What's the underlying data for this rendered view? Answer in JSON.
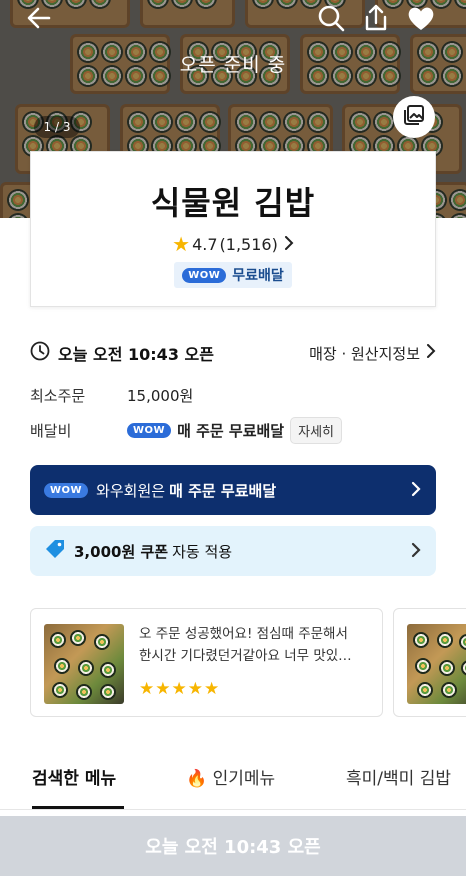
{
  "hero": {
    "status_overlay": "오픈 준비 중",
    "photo_counter": "1 / 3",
    "icons": [
      "back-arrow-icon",
      "search-icon",
      "share-icon",
      "heart-icon",
      "gallery-icon"
    ]
  },
  "store": {
    "name": "식물원 김밥",
    "rating": "4.7",
    "review_count": "(1,516)",
    "wow_badge": "WOW",
    "free_delivery_label": "무료배달"
  },
  "hours": {
    "text": "오늘 오전 10:43 오픈",
    "store_info_link": "매장 · 원산지정보"
  },
  "min_order": {
    "label": "최소주문",
    "value": "15,000원"
  },
  "delivery_fee": {
    "label": "배달비",
    "wow_badge": "WOW",
    "value": "매 주문 무료배달",
    "detail_button": "자세히"
  },
  "wow_banner": {
    "badge": "WOW",
    "prefix": "와우회원은",
    "highlight": "매 주문 무료배달"
  },
  "coupon_banner": {
    "amount": "3,000원 쿠폰",
    "suffix": "자동 적용"
  },
  "reviews": [
    {
      "text": "오 주문 성공했어요! 점심때 주문해서 한시간 기다렸던거같아요 너무 맛있…",
      "stars": "★★★★★"
    }
  ],
  "tabs": [
    {
      "label": "검색한 메뉴",
      "active": true
    },
    {
      "label": "🔥 인기메뉴",
      "active": false
    },
    {
      "label": "흑미/백미 김밥",
      "active": false
    }
  ],
  "bottom_bar": {
    "label": "오늘 오전 10:43 오픈"
  },
  "colors": {
    "wow_blue": "#2b6cd8",
    "wow_banner_bg": "#0d2f6e",
    "coupon_bg": "#e3f3fc",
    "star": "#f7b500",
    "bottom_bar_bg": "#d1d5db"
  }
}
